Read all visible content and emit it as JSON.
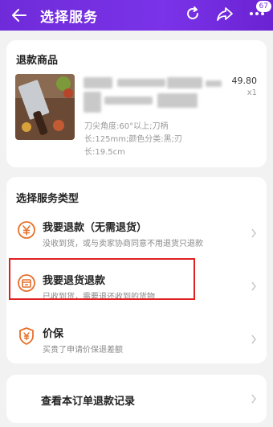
{
  "header": {
    "title": "选择服务",
    "badge_count": "67"
  },
  "product_section": {
    "title": "退款商品",
    "price": "49.80",
    "quantity": "x1",
    "spec_line1": "刀尖角度:60°以上;刀柄",
    "spec_line2": "长:125mm;颜色分类:黑;刃",
    "spec_line3": "长:19.5cm"
  },
  "service_section": {
    "title": "选择服务类型",
    "options": [
      {
        "name": "我要退款（无需退货）",
        "desc": "没收到货，或与卖家协商同意不用退货只退款",
        "icon": "refund-yen-icon"
      },
      {
        "name": "我要退货退款",
        "desc": "已收到货，需要退还收到的货物",
        "icon": "return-box-icon"
      },
      {
        "name": "价保",
        "desc": "买贵了申请价保退差额",
        "icon": "price-protect-shield-icon"
      }
    ]
  },
  "history": {
    "label": "查看本订单退款记录"
  },
  "colors": {
    "header": "#7a33e8",
    "accent": "#e8702a",
    "highlight": "#e02020"
  }
}
